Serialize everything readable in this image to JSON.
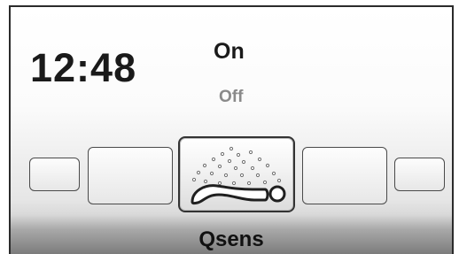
{
  "clock": {
    "time": "12:48"
  },
  "state": {
    "on_label": "On",
    "off_label": "Off"
  },
  "carousel": {
    "selected_mode": "Qsens",
    "selected_icon": "sauna-mist-lying-person-icon",
    "slots": [
      {
        "name": "mode-slot-far-left",
        "icon": ""
      },
      {
        "name": "mode-slot-left",
        "icon": ""
      },
      {
        "name": "mode-slot-selected",
        "icon": "sauna-mist-lying-person-icon"
      },
      {
        "name": "mode-slot-right",
        "icon": ""
      },
      {
        "name": "mode-slot-far-right",
        "icon": ""
      }
    ]
  },
  "colors": {
    "frame": "#2b2b2b",
    "text_primary": "#1a1a1a",
    "text_secondary": "#8a8a8a",
    "bottom_bar": "#7c7c7c"
  }
}
